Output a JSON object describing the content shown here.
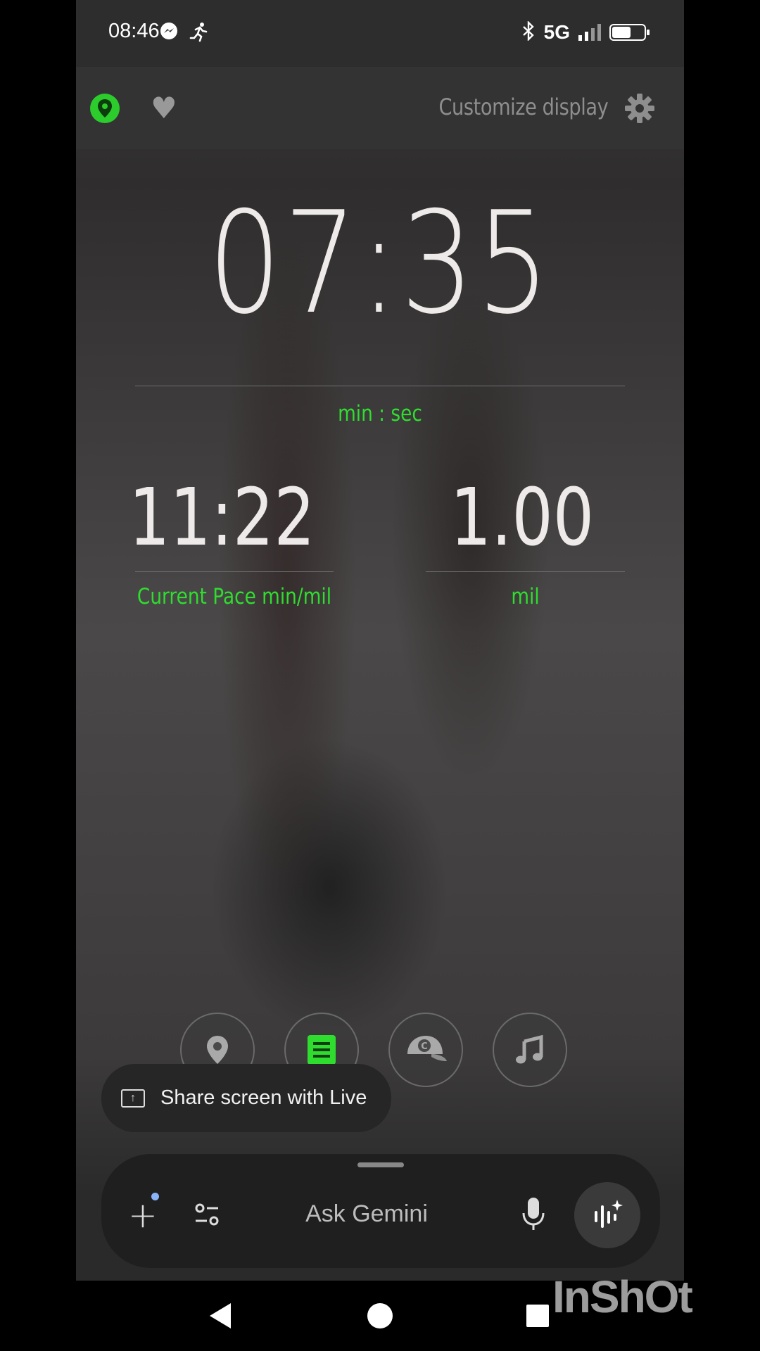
{
  "status_bar": {
    "time": "08:46",
    "network": "5G",
    "icons": [
      "messenger-icon",
      "running-icon",
      "bluetooth-icon",
      "signal-icon",
      "battery-icon"
    ],
    "battery_level": 0.6
  },
  "toolbar": {
    "customize_label": "Customize display",
    "location_color": "#2ccc2c"
  },
  "display": {
    "elapsed": "07:35",
    "elapsed_unit": "min : sec",
    "pace": "11:22",
    "pace_unit": "Current Pace min/mil",
    "distance": "1.00",
    "distance_unit": "mil",
    "accent_color": "#2fdd2f"
  },
  "quick_actions": [
    "location-icon",
    "list-icon",
    "cap-icon",
    "music-icon"
  ],
  "share_screen": {
    "label": "Share screen with Live"
  },
  "gemini": {
    "placeholder": "Ask Gemini"
  },
  "watermark": "InShOt"
}
